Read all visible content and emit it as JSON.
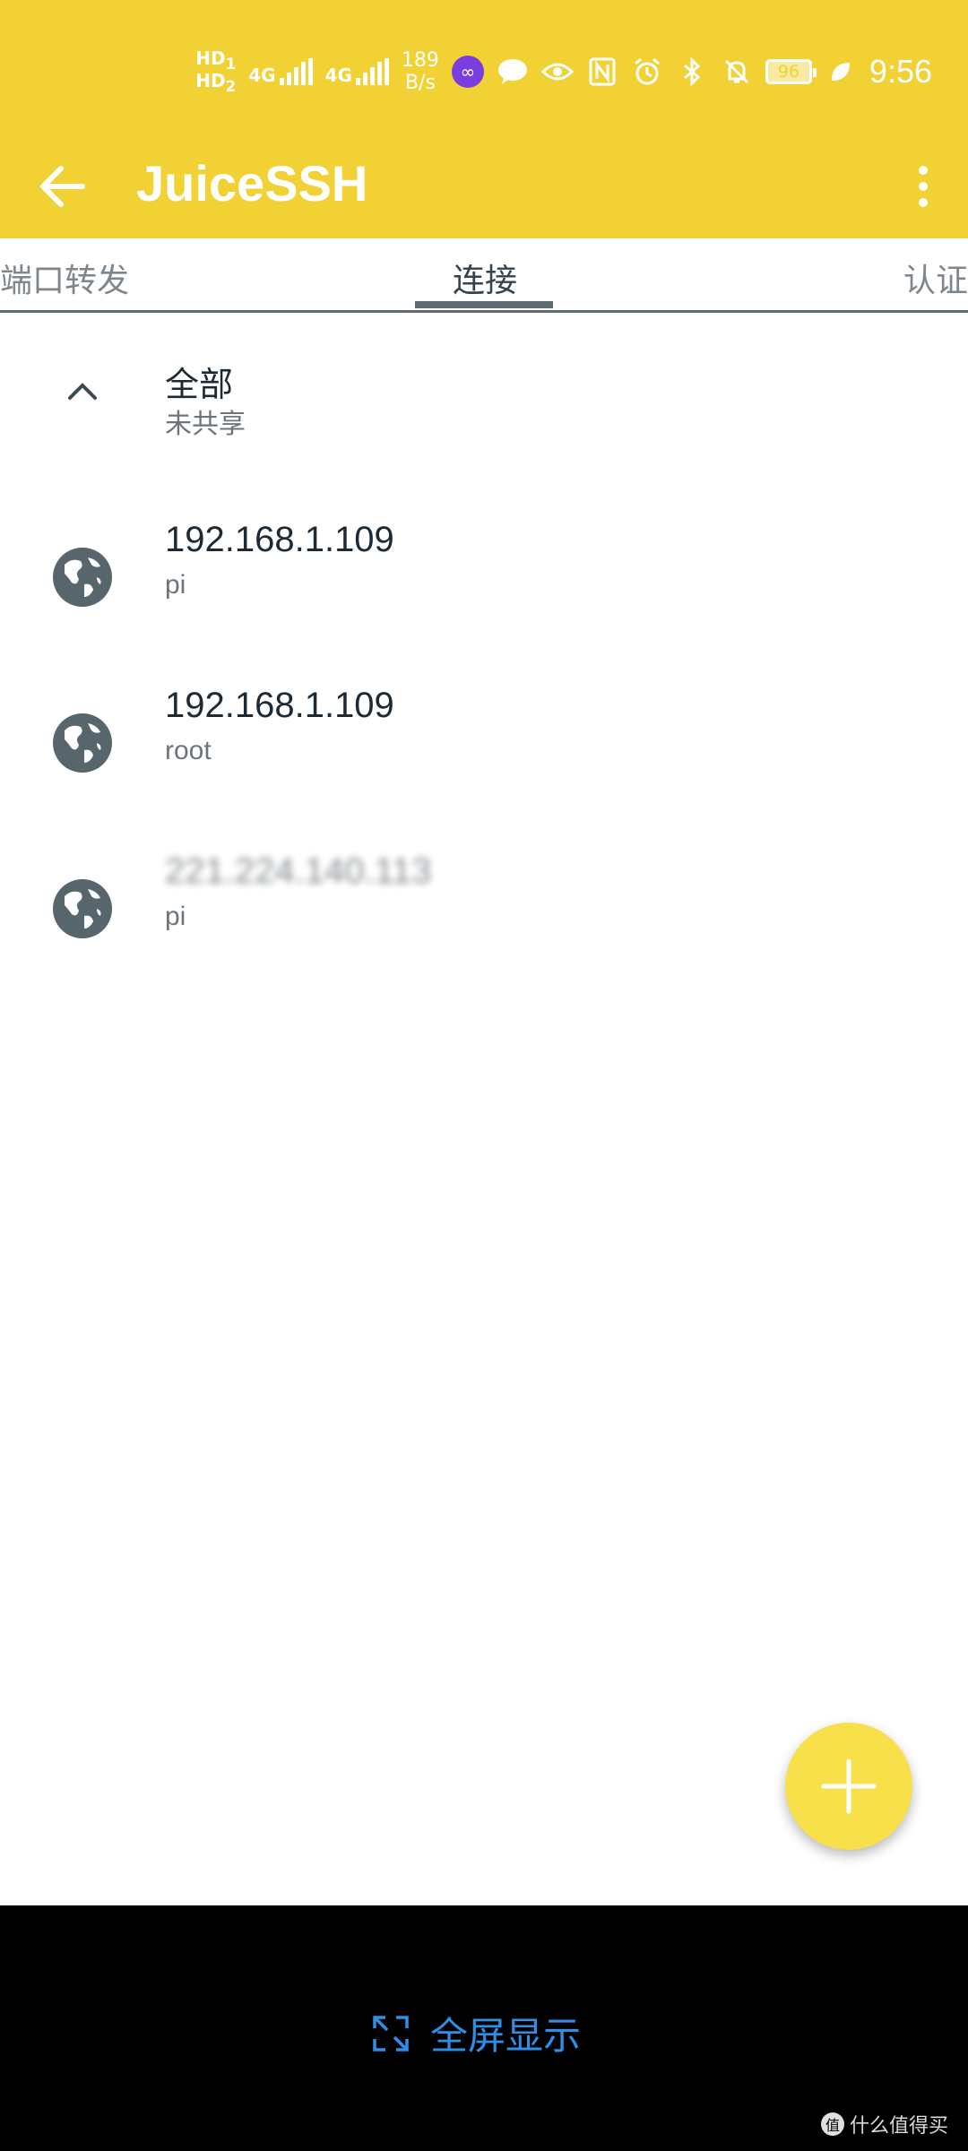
{
  "status_bar": {
    "hd1": "HD",
    "hd1_sub": "1",
    "hd2": "HD",
    "hd2_sub": "2",
    "net1": "4G",
    "net2": "4G",
    "speed_value": "189",
    "speed_unit": "B/s",
    "battery": "96",
    "time": "9:56"
  },
  "app_bar": {
    "title": "JuiceSSH"
  },
  "tabs": [
    {
      "label": "端口转发",
      "active": false
    },
    {
      "label": "连接",
      "active": true
    },
    {
      "label": "认证",
      "active": false
    }
  ],
  "group": {
    "title": "全部",
    "subtitle": "未共享"
  },
  "connections": [
    {
      "host": "192.168.1.109",
      "user": "pi"
    },
    {
      "host": "192.168.1.109",
      "user": "root"
    },
    {
      "host": "221.224.140.113",
      "user": "pi"
    }
  ],
  "bottom_bar": {
    "fullscreen_label": "全屏显示"
  },
  "watermark": {
    "text": "什么值得买",
    "icon": "值"
  },
  "colors": {
    "accent": "#f1d133",
    "fab": "#f8e04b",
    "link": "#2f8fe6"
  }
}
